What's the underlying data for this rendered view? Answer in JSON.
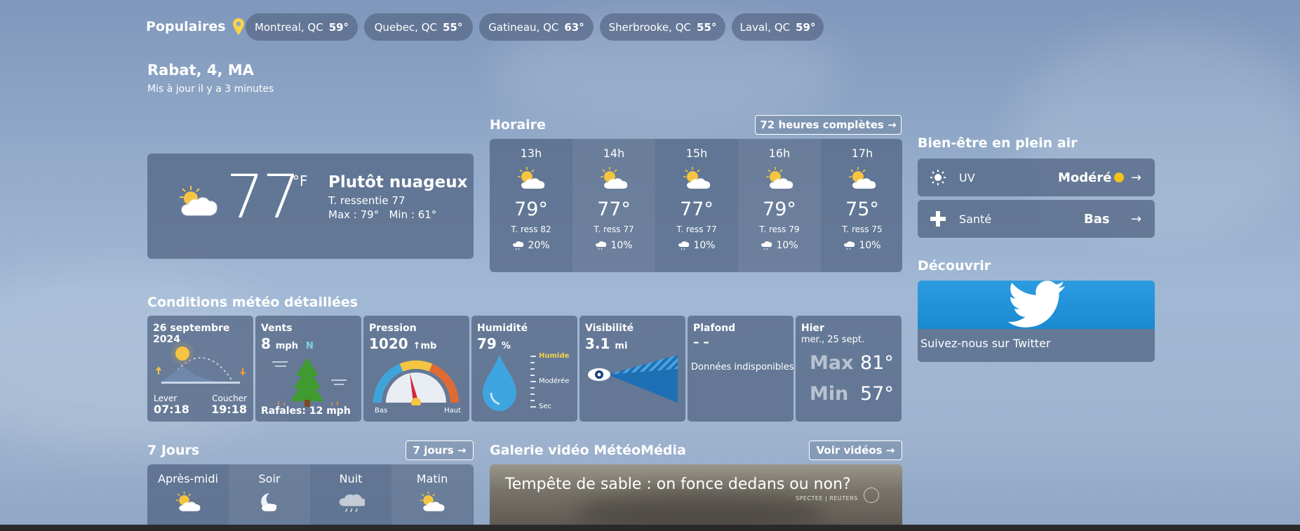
{
  "popular": {
    "title": "Populaires",
    "cities": [
      {
        "name": "Montreal, QC",
        "temp": "59°"
      },
      {
        "name": "Quebec, QC",
        "temp": "55°"
      },
      {
        "name": "Gatineau, QC",
        "temp": "63°"
      },
      {
        "name": "Sherbrooke, QC",
        "temp": "55°"
      },
      {
        "name": "Laval, QC",
        "temp": "59°"
      }
    ]
  },
  "location": {
    "name": "Rabat, 4, MA",
    "updated": "Mis à jour il y a 3 minutes"
  },
  "current": {
    "temp": "77",
    "unit": "°F",
    "condition": "Plutôt nuageux",
    "feels": "T. ressentie 77",
    "maxmin": "Max : 79°   Min : 61°",
    "icon": "partly-cloudy-icon"
  },
  "hourly": {
    "title": "Horaire",
    "button": "72 heures complètes →",
    "hours": [
      {
        "time": "13h",
        "temp": "79°",
        "feels": "T. ress 82",
        "pop": "20%"
      },
      {
        "time": "14h",
        "temp": "77°",
        "feels": "T. ress 77",
        "pop": "10%"
      },
      {
        "time": "15h",
        "temp": "77°",
        "feels": "T. ress 77",
        "pop": "10%"
      },
      {
        "time": "16h",
        "temp": "79°",
        "feels": "T. ress 79",
        "pop": "10%"
      },
      {
        "time": "17h",
        "temp": "75°",
        "feels": "T. ress 75",
        "pop": "10%"
      }
    ]
  },
  "wellness": {
    "title": "Bien-être en plein air",
    "items": [
      {
        "label": "UV",
        "value": "Modéré",
        "dot_color": "#f2c318"
      },
      {
        "label": "Santé",
        "value": "Bas"
      }
    ],
    "arrow": "→"
  },
  "discover": {
    "title": "Découvrir",
    "caption": "Suivez-nous sur Twitter"
  },
  "details": {
    "title": "Conditions météo détaillées",
    "date": "26 septembre 2024",
    "sunrise_label": "Lever",
    "sunrise": "07:18",
    "sunset_label": "Coucher",
    "sunset": "19:18",
    "wind_label": "Vents",
    "wind_value": "8",
    "wind_unit": "mph",
    "wind_dir": "N",
    "gusts": "Rafales: 12 mph",
    "pressure_label": "Pression",
    "pressure_value": "1020",
    "pressure_unit": "↑mb",
    "pressure_low": "Bas",
    "pressure_high": "Haut",
    "humidity_label": "Humidité",
    "humidity_value": "79",
    "humidity_unit": "%",
    "humid_scale": [
      "Humide",
      "Modérée",
      "Sec"
    ],
    "visibility_label": "Visibilité",
    "visibility_value": "3.1",
    "visibility_unit": "mi",
    "ceiling_label": "Plafond",
    "ceiling_value": "– –",
    "ceiling_note": "Données indisponibles",
    "yesterday_label": "Hier",
    "yesterday_date": "mer., 25 sept.",
    "max_label": "Max",
    "max_value": "81°",
    "min_label": "Min",
    "min_value": "57°"
  },
  "seven_days": {
    "title": "7 Jours",
    "button": "7 jours →",
    "periods": [
      "Après-midi",
      "Soir",
      "Nuit",
      "Matin"
    ]
  },
  "gallery": {
    "title": "Galerie vidéo MétéoMédia",
    "button": "Voir vidéos →",
    "video_title": "Tempête de sable : on fonce dedans ou non?",
    "credit": "SPECTEE | REUTERS"
  }
}
